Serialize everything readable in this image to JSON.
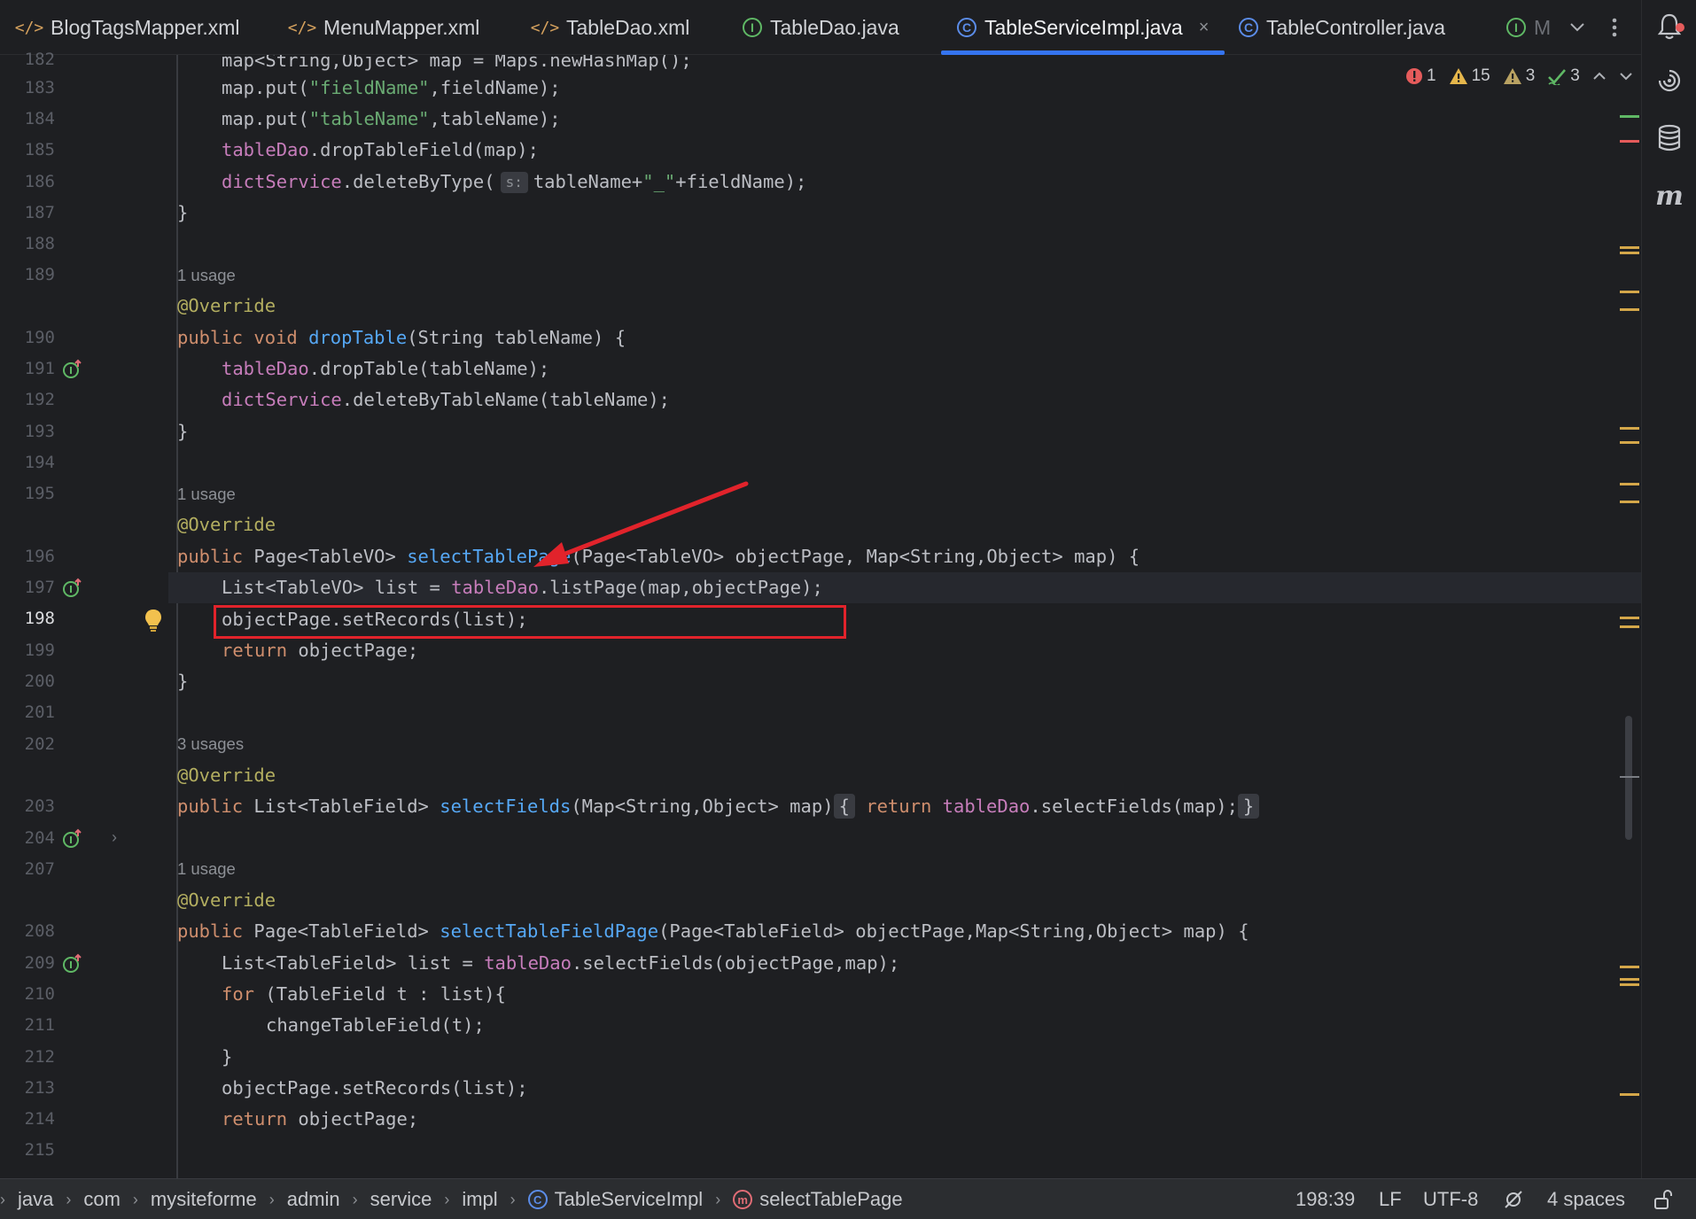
{
  "tabs": [
    {
      "label": "BlogTagsMapper.xml",
      "icon": "xml-icon",
      "active": false
    },
    {
      "label": "MenuMapper.xml",
      "icon": "xml-icon",
      "active": false
    },
    {
      "label": "TableDao.xml",
      "icon": "xml-icon",
      "active": false
    },
    {
      "label": "TableDao.java",
      "icon": "interface-icon",
      "active": false
    },
    {
      "label": "TableServiceImpl.java",
      "icon": "class-icon",
      "active": true
    },
    {
      "label": "TableController.java",
      "icon": "class-icon",
      "active": false
    },
    {
      "label": "M",
      "icon": "interface-icon",
      "active": false
    }
  ],
  "inspections": {
    "errors": "1",
    "warnings": "15",
    "weak_warnings": "3",
    "typos": "3"
  },
  "hints": {
    "h189": "1 usage",
    "h195": "1 usage",
    "h202": "3 usages",
    "h207": "1 usage",
    "param_s": "s:"
  },
  "line_numbers": [
    "182",
    "183",
    "184",
    "185",
    "186",
    "187",
    "188",
    "189",
    "190",
    "191",
    "192",
    "193",
    "194",
    "195",
    "196",
    "197",
    "198",
    "199",
    "200",
    "201",
    "202",
    "203",
    "204",
    "207",
    "208",
    "209",
    "210",
    "211",
    "212",
    "213",
    "214",
    "215"
  ],
  "current_line": "198",
  "code": {
    "l182": "map<String,Object> map = Maps.newHashMap();",
    "l183a": "map.put(",
    "l183s": "\"fieldName\"",
    "l183b": ",fieldName);",
    "l184a": "map.put(",
    "l184s": "\"tableName\"",
    "l184b": ",tableName);",
    "l185f": "tableDao",
    "l185b": ".dropTableField(map);",
    "l186f": "dictService",
    "l186a": ".deleteByType(",
    "l186b": "tableName+",
    "l186s": "\"_\"",
    "l186c": "+fieldName);",
    "l187": "}",
    "l190": "@Override",
    "l191k": "public void ",
    "l191f": "dropTable",
    "l191b": "(String tableName) {",
    "l192f": "tableDao",
    "l192b": ".dropTable(tableName);",
    "l193f": "dictService",
    "l193b": ".deleteByTableName(tableName);",
    "l194": "}",
    "l196": "@Override",
    "l197k": "public ",
    "l197a": "Page<TableVO> ",
    "l197f": "selectTablePage",
    "l197b": "(Page<TableVO> objectPage, Map<String,Object> map) {",
    "l198a": "List<TableVO> list = ",
    "l198f": "tableDao",
    "l198b": ".listPage(map,objectPage);",
    "l199": "objectPage.setRecords(list);",
    "l200k": "return ",
    "l200b": "objectPage;",
    "l201": "}",
    "l203": "@Override",
    "l204k": "public ",
    "l204a": "List<TableField> ",
    "l204f": "selectFields",
    "l204b": "(Map<String,Object> map)",
    "l204o": "{",
    "l204r": "return ",
    "l204d": "tableDao",
    "l204e": ".selectFields(map);",
    "l204c": "}",
    "l208": "@Override",
    "l209k": "public ",
    "l209a": "Page<TableField> ",
    "l209f": "selectTableFieldPage",
    "l209b": "(Page<TableField> objectPage,Map<String,Object> map) {",
    "l210a": "List<TableField> list = ",
    "l210f": "tableDao",
    "l210b": ".selectFields(objectPage,map);",
    "l211k": "for ",
    "l211b": "(TableField t : list){",
    "l212": "changeTableField(t);",
    "l213": "}",
    "l214": "objectPage.setRecords(list);",
    "l215k": "return ",
    "l215b": "objectPage;"
  },
  "breadcrumb": [
    "java",
    "com",
    "mysiteforme",
    "admin",
    "service",
    "impl",
    "TableServiceImpl",
    "selectTablePage"
  ],
  "status": {
    "position": "198:39",
    "line_sep": "LF",
    "encoding": "UTF-8",
    "indent": "4 spaces"
  },
  "colors": {
    "accent": "#3574f0",
    "highlight_box": "#e1232b",
    "arrow": "#e1232b"
  }
}
